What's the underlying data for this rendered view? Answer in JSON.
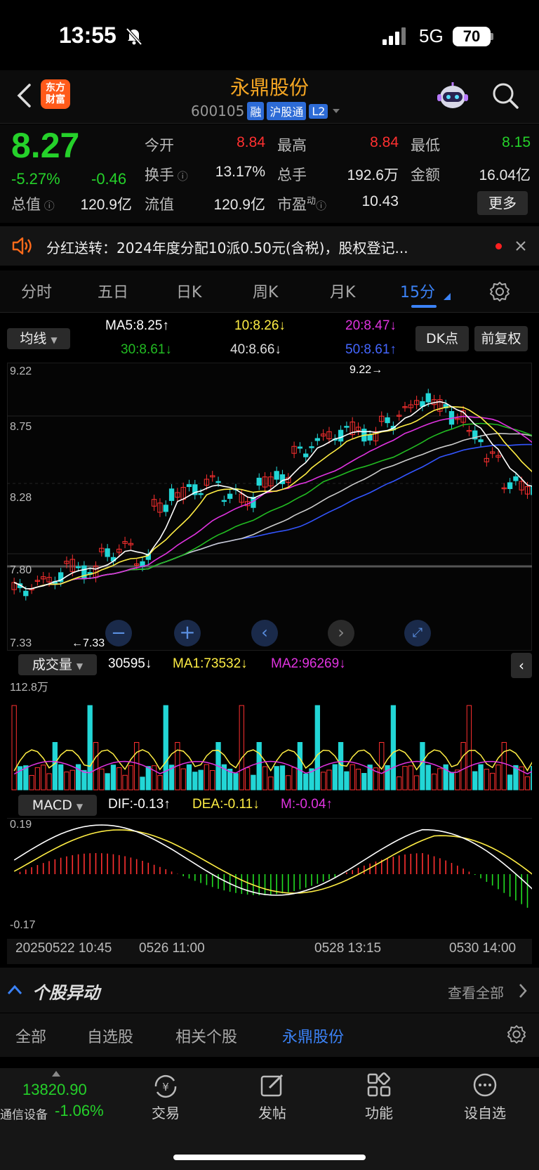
{
  "status_bar": {
    "time": "13:55",
    "network": "5G",
    "battery": "70"
  },
  "nav": {
    "logo_line1": "东方",
    "logo_line2": "财富",
    "title": "永鼎股份",
    "code": "600105",
    "tags": [
      "融",
      "沪股通",
      "L2"
    ]
  },
  "quote": {
    "price": "8.27",
    "change_pct": "-5.27%",
    "change_abs": "-0.46",
    "fields": [
      {
        "label": "今开",
        "value": "8.84",
        "color": "#ff3030"
      },
      {
        "label": "最高",
        "value": "8.84",
        "color": "#ff3030"
      },
      {
        "label": "最低",
        "value": "8.15",
        "color": "#25d12a"
      },
      {
        "label": "换手",
        "value": "13.17%",
        "color": "#e8e8e8"
      },
      {
        "label": "总手",
        "value": "192.6万",
        "color": "#e8e8e8"
      },
      {
        "label": "金额",
        "value": "16.04亿",
        "color": "#e8e8e8"
      },
      {
        "label": "总值",
        "value": "120.9亿",
        "color": "#e8e8e8"
      },
      {
        "label": "流值",
        "value": "120.9亿",
        "color": "#e8e8e8"
      },
      {
        "label": "市盈",
        "value": "10.43",
        "color": "#e8e8e8"
      }
    ],
    "pe_superscript": "动",
    "more_label": "更多"
  },
  "notice": {
    "text": "分红送转：2024年度分配10派0.50元(含税)，股权登记..."
  },
  "period_tabs": [
    "分时",
    "五日",
    "日K",
    "周K",
    "月K",
    "15分"
  ],
  "active_tab": "15分",
  "ma_bar": {
    "selector": "均线",
    "ma5": "MA5:8.25↑",
    "ma10": "10:8.26↓",
    "ma20": "20:8.47↓",
    "ma30": "30:8.61↓",
    "ma40": "40:8.66↓",
    "ma50": "50:8.61↑",
    "dk_button": "DK点",
    "restore_button": "前复权"
  },
  "price_chart": {
    "y_labels": [
      "9.22",
      "8.75",
      "8.28",
      "7.80",
      "7.33"
    ],
    "high_marker": "9.22→",
    "low_marker": "←7.33",
    "colors": {
      "ma5": "#ffffff",
      "ma10": "#ffee44",
      "ma20": "#e033e0",
      "ma30": "#22bb22",
      "ma40": "#cccccc",
      "ma50": "#3355ff",
      "up": "#ff3030",
      "down": "#22d6d6"
    }
  },
  "volume": {
    "selector": "成交量",
    "current": "30595↓",
    "ma1": "MA1:73532↓",
    "ma2": "MA2:96269↓",
    "max_label": "112.8万"
  },
  "macd": {
    "selector": "MACD",
    "dif": "DIF:-0.13↑",
    "dea": "DEA:-0.11↓",
    "m": "M:-0.04↑",
    "y_top": "0.19",
    "y_bottom": "-0.17"
  },
  "x_axis": [
    "20250522 10:45",
    "0526 11:00",
    "0528 13:15",
    "0530 14:00"
  ],
  "stock_movement": {
    "title": "个股异动",
    "view_all": "查看全部"
  },
  "bottom_tabs": [
    "全部",
    "自选股",
    "相关个股",
    "永鼎股份"
  ],
  "dock": {
    "index_value": "13820.90",
    "index_name": "通信设备",
    "index_change": "-1.06%",
    "buttons": [
      "交易",
      "发帖",
      "功能",
      "设自选"
    ]
  }
}
